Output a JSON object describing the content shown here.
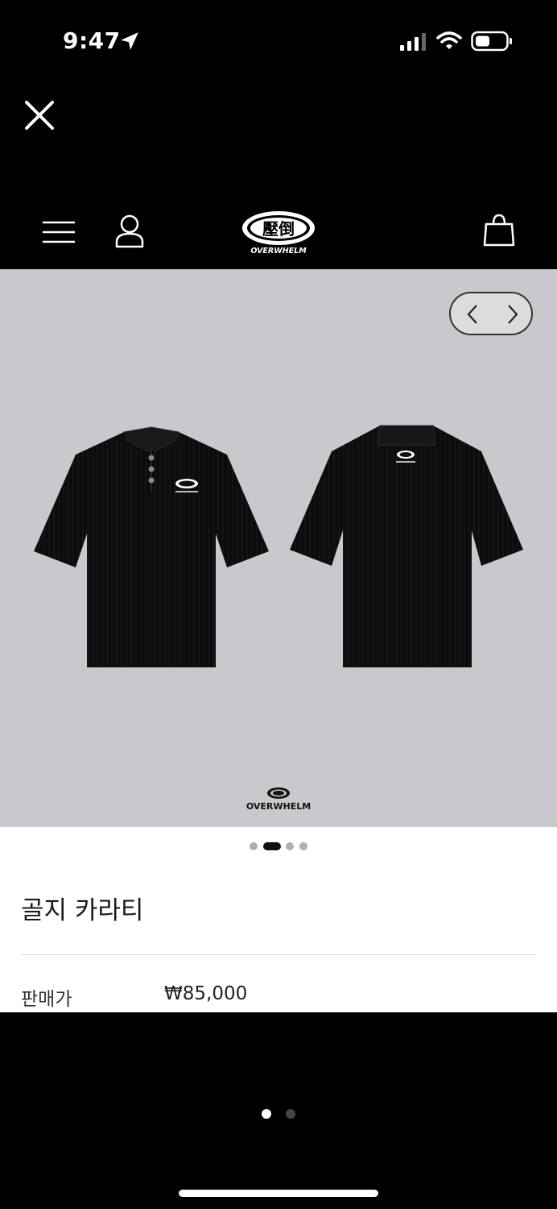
{
  "status_bar": {
    "time": "9:47",
    "icons": [
      "location-arrow-icon",
      "cellular-signal-icon",
      "wifi-icon",
      "battery-icon"
    ]
  },
  "header": {
    "close_icon": "close-icon",
    "menu_icon": "hamburger-menu-icon",
    "account_icon": "user-icon",
    "cart_icon": "shopping-bag-icon",
    "logo_mark": "壓倒",
    "logo_text": "OVERWHELM"
  },
  "gallery": {
    "background": "#cac8cc",
    "prev_icon": "chevron-left-icon",
    "next_icon": "chevron-right-icon",
    "watermark_text": "OVERWHELM",
    "slide_count": 4,
    "active_slide": 2
  },
  "product": {
    "name": "골지 카라티",
    "price_label": "판매가",
    "price": "₩85,000"
  },
  "pager": {
    "page_count": 2,
    "active_page": 1
  }
}
